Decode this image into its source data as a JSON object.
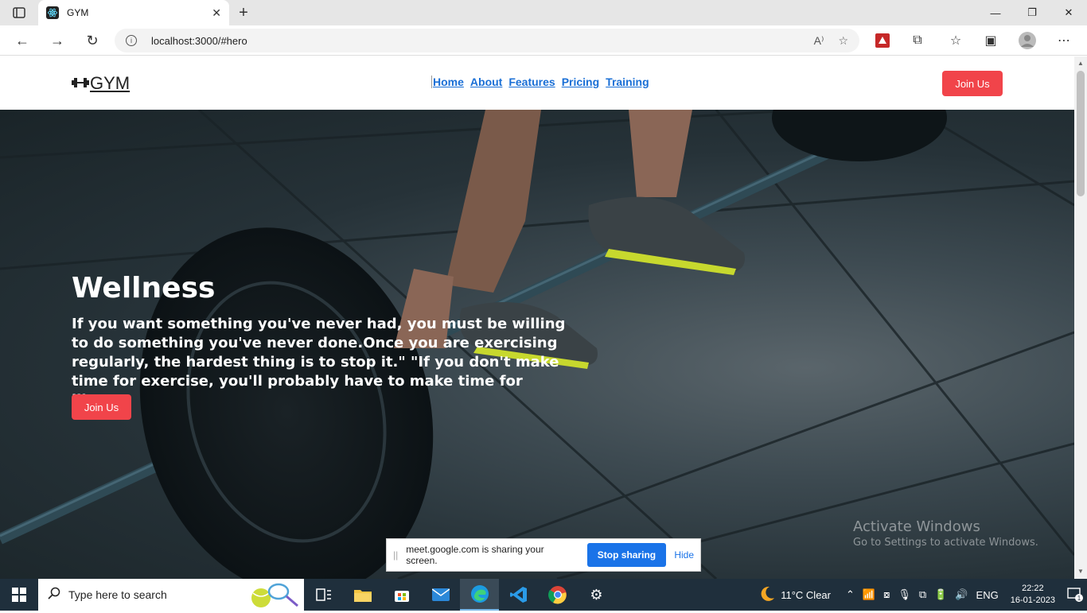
{
  "browser": {
    "tab_title": "GYM",
    "url": "localhost:3000/#hero"
  },
  "site": {
    "logo_text": "GYM",
    "nav": [
      "Home",
      "About",
      "Features",
      "Pricing",
      "Training"
    ],
    "header_join_label": "Join Us"
  },
  "hero": {
    "title": "Wellness",
    "text": "If you want something you've never had, you must be willing to do something you've never done.Once you are exercising regularly, the hardest thing is to stop it.\" \"If you don't make time for exercise, you'll probably have to make time for illness.",
    "join_label": "Join Us"
  },
  "watermark": {
    "line1": "Activate Windows",
    "line2": "Go to Settings to activate Windows."
  },
  "share_bar": {
    "message": "meet.google.com is sharing your screen.",
    "stop_label": "Stop sharing",
    "hide_label": "Hide"
  },
  "taskbar": {
    "search_placeholder": "Type here to search",
    "weather": "11°C  Clear",
    "language": "ENG",
    "time": "22:22",
    "date": "16-01-2023",
    "notification_count": "1"
  },
  "colors": {
    "accent": "#f1444a",
    "nav_link": "#1a6fd6",
    "taskbar": "#1f2f3c",
    "share_button": "#1a73e8"
  }
}
